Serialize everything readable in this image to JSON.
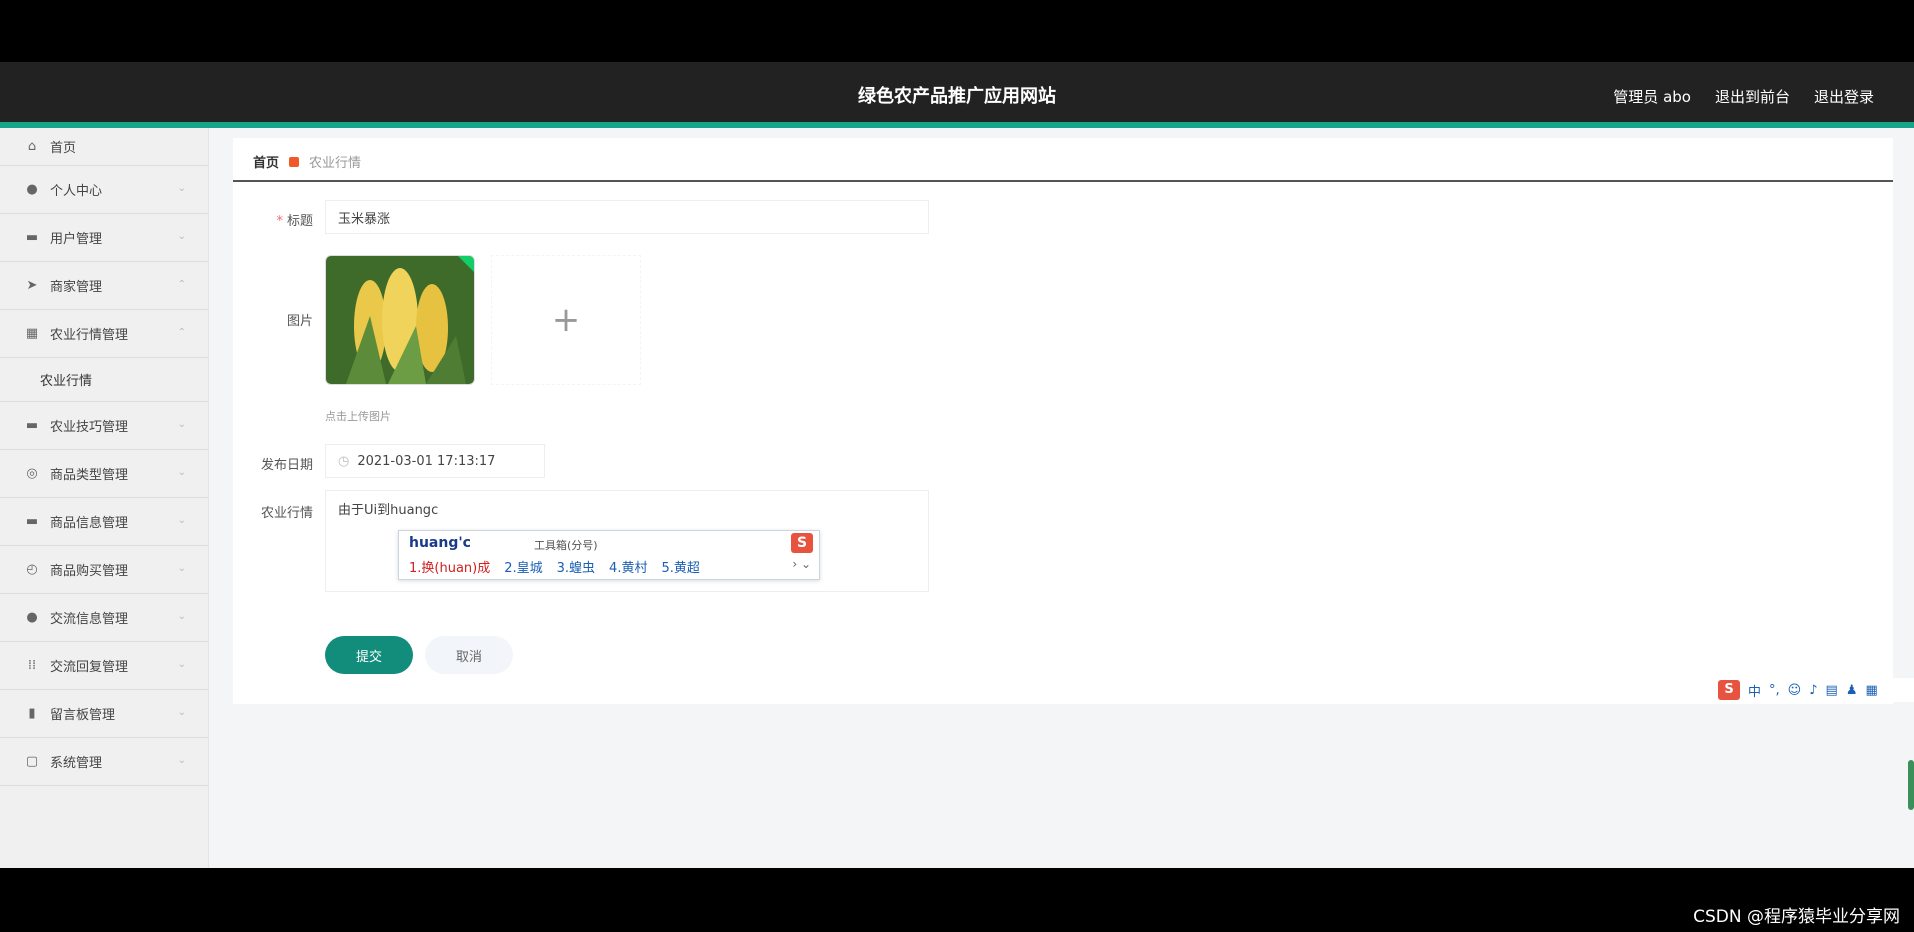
{
  "header": {
    "site_title": "绿色农产品推广应用网站",
    "user_label": "管理员 abo",
    "exit_front_label": "退出到前台",
    "logout_label": "退出登录"
  },
  "sidebar": {
    "items": [
      {
        "label": "首页",
        "icon": "home-icon"
      },
      {
        "label": "个人中心",
        "icon": "user-icon"
      },
      {
        "label": "用户管理",
        "icon": "users-icon"
      },
      {
        "label": "商家管理",
        "icon": "send-icon"
      },
      {
        "label": "农业行情管理",
        "icon": "grid-icon"
      },
      {
        "label": "农业技巧管理",
        "icon": "chat-icon"
      },
      {
        "label": "商品类型管理",
        "icon": "tag-icon"
      },
      {
        "label": "商品信息管理",
        "icon": "box-icon"
      },
      {
        "label": "商品购买管理",
        "icon": "cart-icon"
      },
      {
        "label": "交流信息管理",
        "icon": "person-icon"
      },
      {
        "label": "交流回复管理",
        "icon": "dots-icon"
      },
      {
        "label": "留言板管理",
        "icon": "chart-icon"
      },
      {
        "label": "系统管理",
        "icon": "system-icon"
      }
    ],
    "sub_item": "农业行情"
  },
  "breadcrumb": {
    "home": "首页",
    "current": "农业行情"
  },
  "form": {
    "title_label": "标题",
    "title_value": "玉米暴涨",
    "image_label": "图片",
    "upload_hint": "点击上传图片",
    "date_label": "发布日期",
    "date_value": "2021-03-01 17:13:17",
    "content_label": "农业行情",
    "content_value": "由于Ui到huangc",
    "submit_label": "提交",
    "cancel_label": "取消"
  },
  "ime": {
    "input": "huang'c",
    "tool_hint": "工具箱(分号)",
    "candidates": [
      "1.换(huan)成",
      "2.皇城",
      "3.蝗虫",
      "4.黄村",
      "5.黄超"
    ],
    "status_mode": "中"
  },
  "watermark": "CSDN @程序猿毕业分享网"
}
